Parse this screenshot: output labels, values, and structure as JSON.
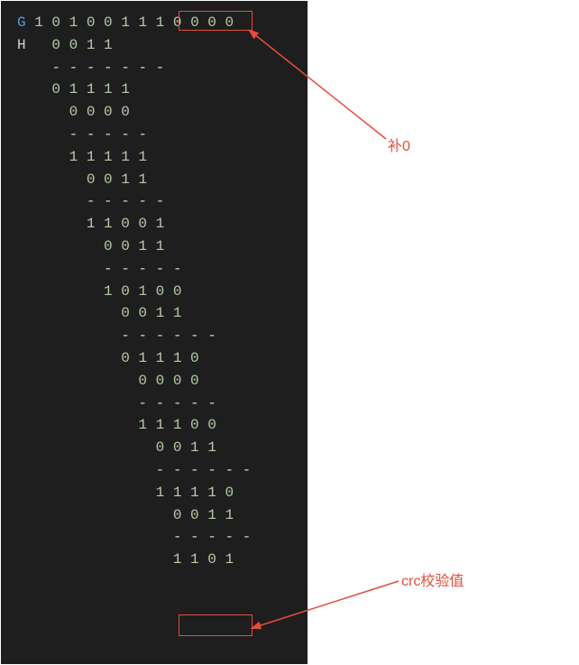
{
  "labels": {
    "G": "G",
    "H": "H"
  },
  "dividend": "1 0 1 0 0 1 1 1",
  "padding": "0 0 0 0",
  "division": {
    "step1": {
      "xor": "0 0 1 1",
      "dashes": "- - - - - - -"
    },
    "step2": {
      "remainder": "0 1 1 1 1",
      "xor": "0 0 0 0",
      "dashes": "- - - - -"
    },
    "step3": {
      "remainder": "1 1 1 1 1",
      "xor": "0 0 1 1",
      "dashes": "- - - - -"
    },
    "step4": {
      "remainder": "1 1 0 0 1",
      "xor": "0 0 1 1",
      "dashes": "- - - - -"
    },
    "step5": {
      "remainder": "1 0 1 0 0",
      "xor": "0 0 1 1",
      "dashes": "- - - - - -"
    },
    "step6": {
      "remainder": "0 1 1 1 0",
      "xor": "0 0 0 0",
      "dashes": "- - - - -"
    },
    "step7": {
      "remainder": "1 1 1 0 0",
      "xor": "0 0 1 1",
      "dashes": "- - - - - -"
    },
    "step8": {
      "remainder": "1 1 1 1 0",
      "xor": "0 0 1 1",
      "dashes": "- - - - -"
    },
    "result": "1 1 0 1"
  },
  "annotations": {
    "padding_label": "补0",
    "crc_label": "crc校验值"
  }
}
